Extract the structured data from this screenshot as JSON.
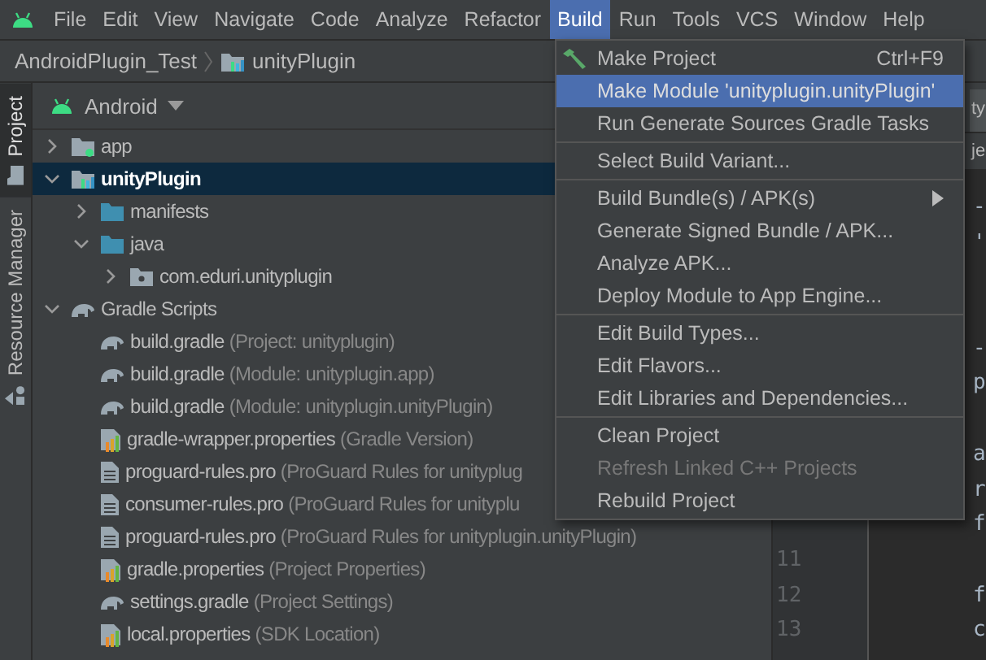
{
  "menubar": [
    {
      "label": "File",
      "selected": false
    },
    {
      "label": "Edit",
      "selected": false
    },
    {
      "label": "View",
      "selected": false
    },
    {
      "label": "Navigate",
      "selected": false
    },
    {
      "label": "Code",
      "selected": false
    },
    {
      "label": "Analyze",
      "selected": false
    },
    {
      "label": "Refactor",
      "selected": false
    },
    {
      "label": "Build",
      "selected": true
    },
    {
      "label": "Run",
      "selected": false
    },
    {
      "label": "Tools",
      "selected": false
    },
    {
      "label": "VCS",
      "selected": false
    },
    {
      "label": "Window",
      "selected": false
    },
    {
      "label": "Help",
      "selected": false
    }
  ],
  "breadcrumb": [
    "AndroidPlugin_Test",
    "unityPlugin"
  ],
  "side_tabs": [
    {
      "label": "Project",
      "selected": true
    },
    {
      "label": "Resource Manager",
      "selected": false
    }
  ],
  "project_view": {
    "mode": "Android"
  },
  "tree": [
    {
      "label": "app",
      "kind": "app",
      "expanded": false,
      "selected": false
    },
    {
      "label": "unityPlugin",
      "kind": "module",
      "expanded": true,
      "selected": true,
      "children": [
        {
          "label": "manifests",
          "kind": "folder",
          "expanded": false,
          "selected": false
        },
        {
          "label": "java",
          "kind": "folder",
          "expanded": true,
          "selected": false,
          "children": [
            {
              "label": "com.eduri.unityplugin",
              "kind": "package",
              "expanded": false,
              "selected": false
            }
          ]
        }
      ]
    },
    {
      "label": "Gradle Scripts",
      "kind": "gradle",
      "expanded": true,
      "selected": false,
      "children": [
        {
          "label": "build.gradle",
          "hint": "(Project: unityplugin)",
          "kind": "gradle",
          "selected": false
        },
        {
          "label": "build.gradle",
          "hint": "(Module: unityplugin.app)",
          "kind": "gradle",
          "selected": false
        },
        {
          "label": "build.gradle",
          "hint": "(Module: unityplugin.unityPlugin)",
          "kind": "gradle",
          "selected": false
        },
        {
          "label": "gradle-wrapper.properties",
          "hint": "(Gradle Version)",
          "kind": "properties",
          "selected": false
        },
        {
          "label": "proguard-rules.pro",
          "hint": "(ProGuard Rules for unityplug",
          "kind": "text",
          "selected": false
        },
        {
          "label": "consumer-rules.pro",
          "hint": "(ProGuard Rules for unityplu",
          "kind": "text",
          "selected": false
        },
        {
          "label": "proguard-rules.pro",
          "hint": "(ProGuard Rules for unityplugin.unityPlugin)",
          "kind": "text",
          "selected": false
        },
        {
          "label": "gradle.properties",
          "hint": "(Project Properties)",
          "kind": "properties",
          "selected": false
        },
        {
          "label": "settings.gradle",
          "hint": "(Project Settings)",
          "kind": "gradle",
          "selected": false
        },
        {
          "label": "local.properties",
          "hint": "(SDK Location)",
          "kind": "properties",
          "selected": false
        }
      ]
    }
  ],
  "editor": {
    "tab": "ty",
    "nav": "je",
    "lines": [
      {
        "kind": "line",
        "code": "-"
      },
      {
        "kind": "line",
        "code": "'"
      },
      {
        "kind": "blank"
      },
      {
        "kind": "blank"
      },
      {
        "kind": "line",
        "code": "-"
      },
      {
        "kind": "line",
        "code": "p"
      },
      {
        "kind": "blank"
      },
      {
        "kind": "line",
        "code": "a"
      },
      {
        "kind": "line",
        "code": "r"
      },
      {
        "kind": "line",
        "code": "f"
      },
      {
        "kind": "line",
        "number": "11"
      },
      {
        "kind": "line",
        "number": "12",
        "code": "f"
      },
      {
        "kind": "line",
        "number": "13",
        "code": "c"
      }
    ]
  },
  "build_menu": {
    "groups": [
      [
        {
          "label": "Make Project",
          "shortcut": "Ctrl+F9",
          "kind": "hammer",
          "selected": false,
          "disabled": false
        },
        {
          "label": "Make Module 'unityplugin.unityPlugin'",
          "selected": true,
          "disabled": false
        },
        {
          "label": "Run Generate Sources Gradle Tasks",
          "selected": false,
          "disabled": false
        }
      ],
      [
        {
          "label": "Select Build Variant...",
          "selected": false,
          "disabled": false
        }
      ],
      [
        {
          "label": "Build Bundle(s) / APK(s)",
          "submenu": true,
          "selected": false,
          "disabled": false
        },
        {
          "label": "Generate Signed Bundle / APK...",
          "selected": false,
          "disabled": false
        },
        {
          "label": "Analyze APK...",
          "selected": false,
          "disabled": false
        },
        {
          "label": "Deploy Module to App Engine...",
          "selected": false,
          "disabled": false
        }
      ],
      [
        {
          "label": "Edit Build Types...",
          "selected": false,
          "disabled": false
        },
        {
          "label": "Edit Flavors...",
          "selected": false,
          "disabled": false
        },
        {
          "label": "Edit Libraries and Dependencies...",
          "selected": false,
          "disabled": false
        }
      ],
      [
        {
          "label": "Clean Project",
          "selected": false,
          "disabled": false
        },
        {
          "label": "Refresh Linked C++ Projects",
          "selected": false,
          "disabled": true
        },
        {
          "label": "Rebuild Project",
          "selected": false,
          "disabled": false
        }
      ]
    ]
  }
}
